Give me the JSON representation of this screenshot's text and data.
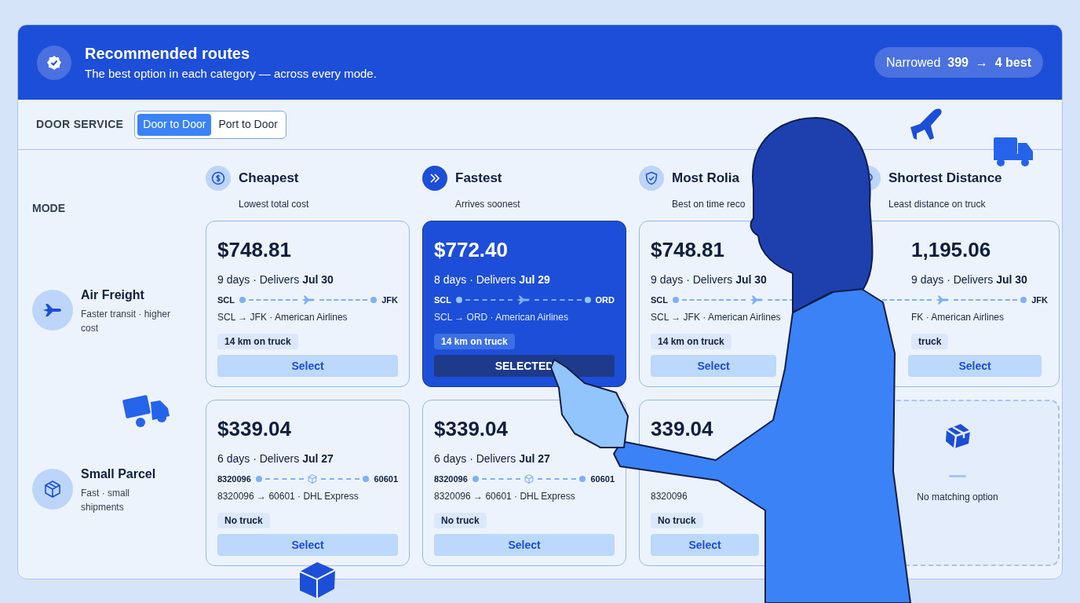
{
  "header": {
    "title": "Recommended routes",
    "subtitle": "The best option in each category — across every mode.",
    "badge": "Narrowed  **399**  →  **4 best**"
  },
  "filter": {
    "label": "DOOR SERVICE",
    "options": [
      {
        "label": "Door to Door",
        "selected": true
      },
      {
        "label": "Port to Door",
        "selected": false
      }
    ]
  },
  "mode_heading": "MODE",
  "categories": [
    {
      "kind": "cost",
      "title": "Cheapest",
      "subtitle": "Lowest total cost"
    },
    {
      "kind": "speed",
      "title": "Fastest",
      "subtitle": "Arrives soonest"
    },
    {
      "kind": "reliability",
      "title": "Most Rolia",
      "subtitle": "Best on time reco"
    },
    {
      "kind": "distance",
      "title": "Shortest Distance",
      "subtitle": "Least distance on truck"
    }
  ],
  "rows": [
    {
      "kind": "air",
      "name": "Air Freight",
      "description": "Faster transit · higher cost",
      "options": [
        {
          "kind": "route",
          "price": "$748.81",
          "schedule": "9 days · Delivers **Jul 30**",
          "from": "SCL",
          "to": "JFK",
          "route_text": "SCL → JFK · American Airlines",
          "chip": "14 km on truck",
          "button": {
            "label": "Select",
            "selected": false
          }
        },
        {
          "kind": "route",
          "price": "$772.40",
          "schedule": "8 days · Delivers **Jul 29**",
          "from": "SCL",
          "to": "ORD",
          "route_text": "SCL → ORD · American Airlines",
          "chip": "14 km on truck",
          "button": {
            "label": "SELECTED",
            "selected": true
          }
        },
        {
          "kind": "route",
          "price": "$748.81",
          "schedule": "9 days · Delivers **Jul 30**",
          "from": "SCL",
          "route_text": "SCL → JFK · American Airlines",
          "chip": "14 km on truck",
          "button": {
            "label": "Select",
            "selected": false
          }
        },
        {
          "kind": "route",
          "price": "1,195.06",
          "schedule": "9 days · Delivers **Jul 30**",
          "to": "JFK",
          "route_text": "FK · American Airlines",
          "chip": "truck",
          "button": {
            "label": "Select",
            "selected": false
          }
        }
      ]
    },
    {
      "kind": "parcel",
      "name": "Small Parcel",
      "description": "Fast · small shipments",
      "options": [
        {
          "kind": "route",
          "price": "$339.04",
          "schedule": "6 days · Delivers **Jul 27**",
          "from": "8320096",
          "to": "60601",
          "route_text": "8320096 → 60601 · DHL Express",
          "chip": "No truck",
          "button": {
            "label": "Select",
            "selected": false
          }
        },
        {
          "kind": "route",
          "price": "$339.04",
          "schedule": "6 days · Delivers **Jul 27**",
          "from": "8320096",
          "to": "60601",
          "route_text": "8320096 → 60601 · DHL Express",
          "chip": "No truck",
          "button": {
            "label": "Select",
            "selected": false
          }
        },
        {
          "kind": "route",
          "price": "339.04",
          "route_text": "8320096",
          "chip": "No truck",
          "button": {
            "label": "Select",
            "selected": false
          }
        },
        {
          "kind": "empty",
          "message": "No matching option"
        }
      ]
    }
  ]
}
